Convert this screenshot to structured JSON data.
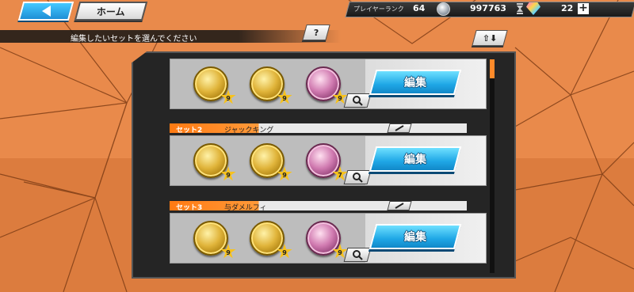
{
  "nav": {
    "back_icon": "back-arrow-icon",
    "home_label": "ホーム"
  },
  "status": {
    "rank_label": "プレイヤーランク",
    "rank_value": "64",
    "coin_icon": "coin-icon",
    "coin_value": "997763",
    "hourglass_icon": "hourglass-icon",
    "gem_icon": "gem-icon",
    "gem_value": "22",
    "plus_label": "+"
  },
  "instruction": "編集したいセットを選んでください",
  "help_label": "?",
  "sort_label": "⇧⬇",
  "sets": [
    {
      "header": "",
      "name": "",
      "medals": [
        {
          "kind": "gold",
          "star": "9"
        },
        {
          "kind": "gold",
          "star": "9"
        },
        {
          "kind": "pink",
          "star": "9"
        }
      ],
      "edit_label": "編集"
    },
    {
      "header": "セット2",
      "name": "ジャックキング",
      "medals": [
        {
          "kind": "gold",
          "star": "9"
        },
        {
          "kind": "gold",
          "star": "9"
        },
        {
          "kind": "pink",
          "star": "7"
        }
      ],
      "edit_label": "編集"
    },
    {
      "header": "セット3",
      "name": "与ダメルフィ",
      "medals": [
        {
          "kind": "gold",
          "star": "9"
        },
        {
          "kind": "gold",
          "star": "9"
        },
        {
          "kind": "pink",
          "star": "9"
        }
      ],
      "edit_label": "編集"
    }
  ],
  "colors": {
    "accent": "#ff7a12",
    "edit_button": "#1fa7e6",
    "panel": "#252525"
  }
}
